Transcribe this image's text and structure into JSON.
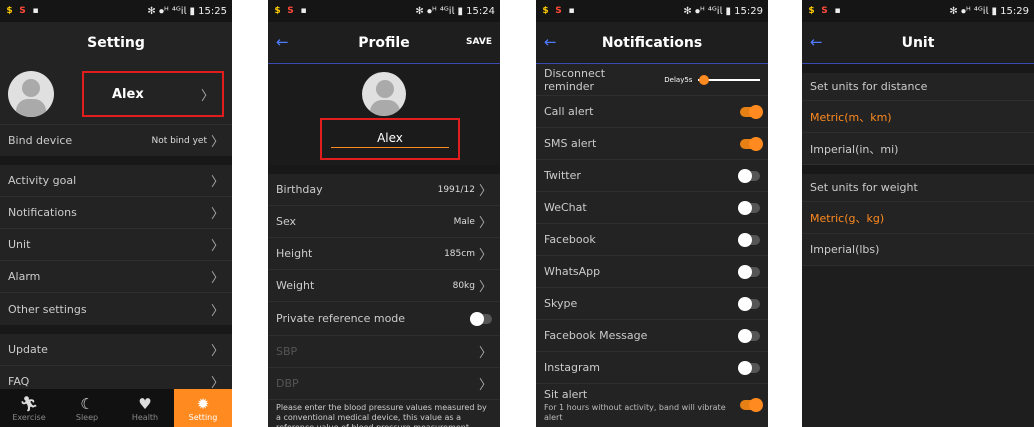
{
  "status": {
    "icons": [
      "$",
      "S",
      "▪"
    ],
    "p1_time": "✻ ⦁ᴴ ⁴ᴳ𝗂𝗅 ▮ 15:25",
    "p2_time": "✻ ⦁ᴴ ⁴ᴳ𝗂𝗅 ▮ 15:24",
    "p3_time": "✻ ⦁ᴴ ⁴ᴳ𝗂𝗅 ▮ 15:29",
    "p4_time": "✻ ⦁ᴴ ⁴ᴳ𝗂𝗅 ▮ 15:29"
  },
  "setting": {
    "title": "Setting",
    "user_name": "Alex",
    "bind_label": "Bind device",
    "bind_value": "Not bind yet",
    "items": [
      "Activity goal",
      "Notifications",
      "Unit",
      "Alarm",
      "Other settings"
    ],
    "update": "Update",
    "faq": "FAQ",
    "nav": [
      {
        "label": "Exercise",
        "icon": "runner-icon"
      },
      {
        "label": "Sleep",
        "icon": "moon-icon"
      },
      {
        "label": "Health",
        "icon": "heart-icon"
      },
      {
        "label": "Setting",
        "icon": "gear-icon"
      }
    ]
  },
  "profile": {
    "title": "Profile",
    "save": "SAVE",
    "name": "Alex",
    "fields": [
      {
        "label": "Birthday",
        "value": "1991/12"
      },
      {
        "label": "Sex",
        "value": "Male"
      },
      {
        "label": "Height",
        "value": "185cm"
      },
      {
        "label": "Weight",
        "value": "80kg"
      }
    ],
    "private_mode": "Private reference mode",
    "sbp": "SBP",
    "dbp": "DBP",
    "note": "Please enter the blood pressure values measured by a conventional medical device, this value as a reference value of blood pressure measurement."
  },
  "notifications": {
    "title": "Notifications",
    "disconnect": "Disconnect reminder",
    "delay": "Delay5s",
    "slider_level": 0.05,
    "items": [
      {
        "label": "Call alert",
        "on": true
      },
      {
        "label": "SMS alert",
        "on": true
      },
      {
        "label": "Twitter",
        "on": false
      },
      {
        "label": "WeChat",
        "on": false
      },
      {
        "label": "Facebook",
        "on": false
      },
      {
        "label": "WhatsApp",
        "on": false
      },
      {
        "label": "Skype",
        "on": false
      },
      {
        "label": "Facebook Message",
        "on": false
      },
      {
        "label": "Instagram",
        "on": false
      }
    ],
    "sit_alert": "Sit alert",
    "sit_desc": "For 1 hours without activity, band will vibrate alert"
  },
  "unit": {
    "title": "Unit",
    "distance_header": "Set units for distance",
    "metric_distance": "Metric(m、km)",
    "imperial_distance": "Imperial(in、mi)",
    "weight_header": "Set units for weight",
    "metric_weight": "Metric(g、kg)",
    "imperial_weight": "Imperial(lbs)"
  }
}
